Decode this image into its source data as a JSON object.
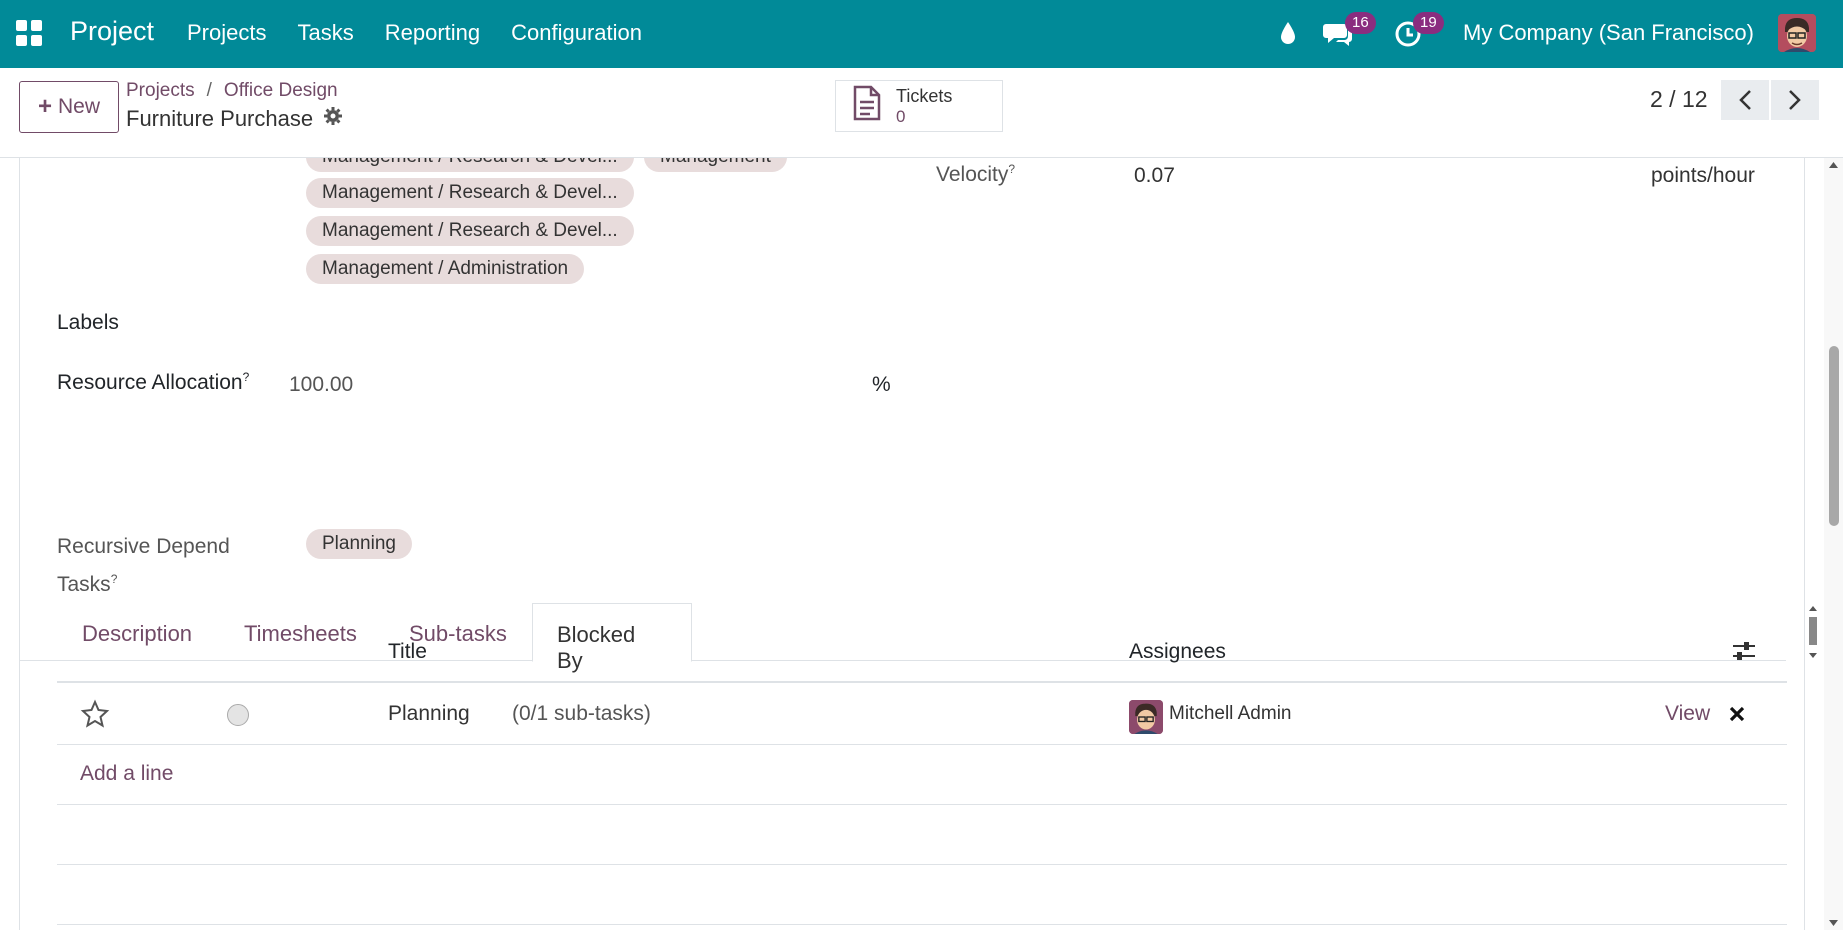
{
  "navbar": {
    "brand": "Project",
    "menu": [
      "Projects",
      "Tasks",
      "Reporting",
      "Configuration"
    ],
    "chat_badge": "16",
    "activity_badge": "19",
    "company": "My Company (San Francisco)"
  },
  "control": {
    "new_label": "New",
    "breadcrumb": {
      "root": "Projects",
      "sep": "/",
      "parent": "Office Design"
    },
    "record_name": "Furniture Purchase",
    "smart_button": {
      "label": "Tickets",
      "count": "0"
    },
    "pager": "2 / 12"
  },
  "form": {
    "tags": [
      "Management / Research & Devel...",
      "Management",
      "Management / Research & Devel...",
      "Management / Research & Devel...",
      "Management / Administration"
    ],
    "velocity_label": "Velocity",
    "velocity_value": "0.07",
    "velocity_unit": "points/hour",
    "labels_label": "Labels",
    "resource_label": "Resource Allocation",
    "resource_value": "100.00",
    "resource_unit": "%",
    "help_mark": "?"
  },
  "tabs": [
    "Description",
    "Timesheets",
    "Sub-tasks",
    "Blocked By"
  ],
  "blocked_by": {
    "recursive_label_1": "Recursive Depend",
    "recursive_label_2": "Tasks",
    "recursive_tag": "Planning",
    "columns": {
      "title": "Title",
      "assignees": "Assignees"
    },
    "rows": [
      {
        "title": "Planning",
        "subtasks": "(0/1 sub-tasks)",
        "assignee": "Mitchell Admin",
        "action": "View"
      }
    ],
    "add_line": "Add a line"
  },
  "colors": {
    "navbar": "#018a98",
    "accent": "#714b67",
    "badge": "#8a2d7f",
    "tag_bg": "#e8dcdc"
  }
}
